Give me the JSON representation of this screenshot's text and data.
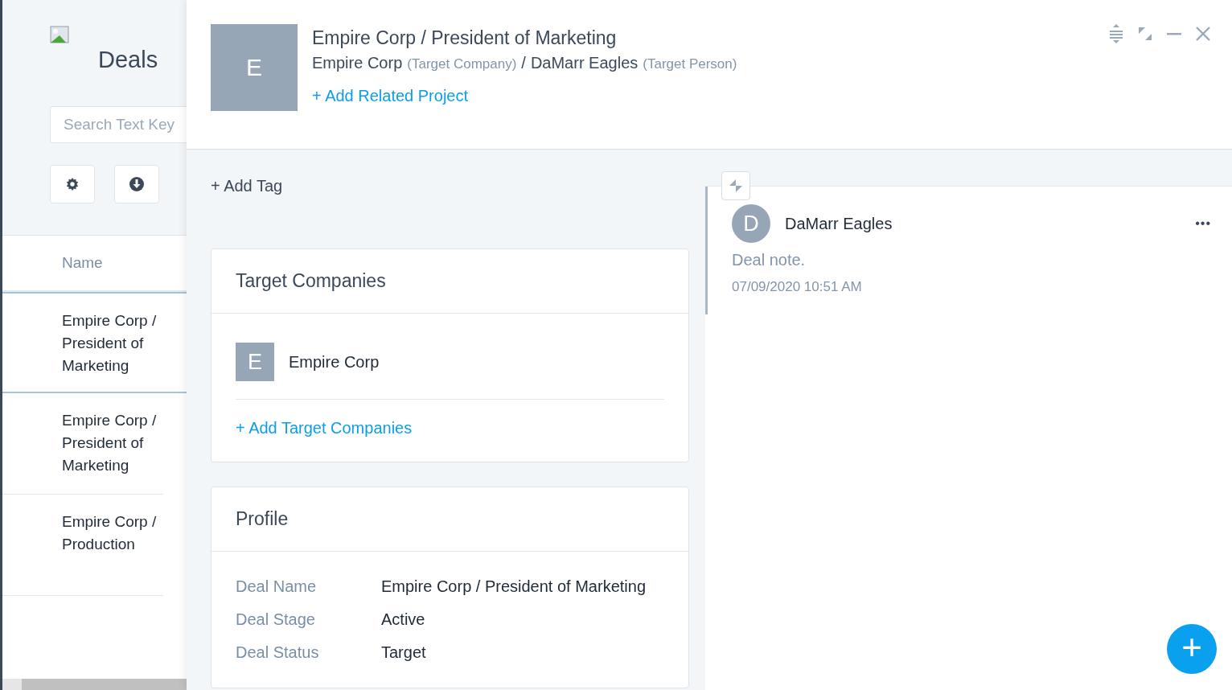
{
  "list_panel": {
    "title": "Deals",
    "search": {
      "placeholder": "Search Text Key"
    },
    "column_header": "Name",
    "rows": [
      {
        "name": "Empire Corp / President of Marketing",
        "selected": true
      },
      {
        "name": "Empire Corp / President of Marketing",
        "selected": false
      },
      {
        "name": "Empire Corp / Production",
        "selected": false
      }
    ]
  },
  "detail": {
    "avatar_letter": "E",
    "title": "Empire Corp / President of Marketing",
    "subtitle": [
      {
        "name": "Empire Corp",
        "role": "(Target Company)"
      },
      {
        "name": "DaMarr Eagles",
        "role": "(Target Person)"
      }
    ],
    "separator": "/",
    "add_related": "+ Add Related Project",
    "add_tag": "+ Add Tag",
    "target_companies": {
      "title": "Target Companies",
      "items": [
        {
          "letter": "E",
          "name": "Empire Corp"
        }
      ],
      "add_link": "+ Add Target Companies"
    },
    "profile": {
      "title": "Profile",
      "fields": [
        {
          "label": "Deal Name",
          "value": "Empire Corp / President of Marketing"
        },
        {
          "label": "Deal Stage",
          "value": "Active"
        },
        {
          "label": "Deal Status",
          "value": "Target"
        }
      ]
    }
  },
  "notes": [
    {
      "avatar_letter": "D",
      "author": "DaMarr Eagles",
      "text": "Deal note.",
      "time": "07/09/2020 10:51 AM",
      "more": "•••"
    }
  ],
  "fab": "+"
}
